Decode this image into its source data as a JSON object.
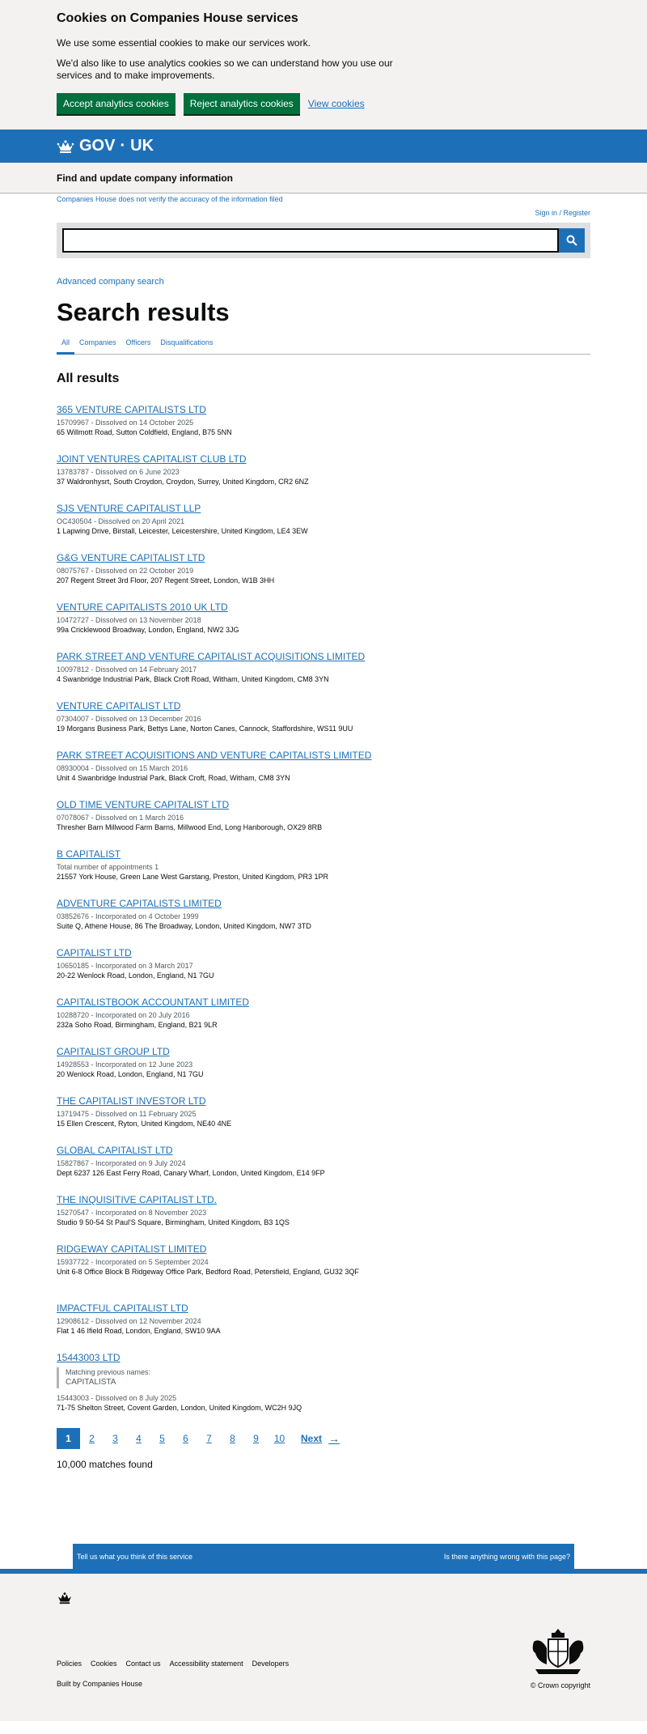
{
  "cookie": {
    "title": "Cookies on Companies House services",
    "p1": "We use some essential cookies to make our services work.",
    "p2": "We'd also like to use analytics cookies so we can understand how you use our services and to make improvements.",
    "accept_label": "Accept analytics cookies",
    "reject_label": "Reject analytics cookies",
    "view_label": "View cookies"
  },
  "header": {
    "logo": "GOV",
    "logo2": "UK",
    "service": "Find and update company information"
  },
  "notice": "Companies House does not verify the accuracy of the information filed",
  "signin": "Sign in / Register",
  "search": {
    "value": "",
    "icon": "search-icon"
  },
  "advanced_link": "Advanced company search",
  "page_title": "Search results",
  "tabs": [
    {
      "label": "All"
    },
    {
      "label": "Companies"
    },
    {
      "label": "Officers"
    },
    {
      "label": "Disqualifications"
    }
  ],
  "results_heading": "All results",
  "results": [
    {
      "title": "365 VENTURE CAPITALISTS LTD",
      "meta": "15709967 - Dissolved on 14 October 2025",
      "address": "65 Willmott Road, Sutton Coldfield, England, B75 5NN"
    },
    {
      "title": "JOINT VENTURES CAPITALIST CLUB LTD",
      "meta": "13783787 - Dissolved on 6 June 2023",
      "address": "37 Waldronhysrt, South Croydon, Croydon, Surrey, United Kingdom, CR2 6NZ"
    },
    {
      "title": "SJS VENTURE CAPITALIST LLP",
      "meta": "OC430504 - Dissolved on 20 April 2021",
      "address": "1 Lapwing Drive, Birstall, Leicester, Leicestershire, United Kingdom, LE4 3EW"
    },
    {
      "title": "G&G VENTURE CAPITALIST LTD",
      "meta": "08075767 - Dissolved on 22 October 2019",
      "address": "207 Regent Street 3rd Floor, 207 Regent Street, London, W1B 3HH"
    },
    {
      "title": "VENTURE CAPITALISTS 2010 UK LTD",
      "meta": "10472727 - Dissolved on 13 November 2018",
      "address": "99a Cricklewood Broadway, London, England, NW2 3JG"
    },
    {
      "title": "PARK STREET AND VENTURE CAPITALIST ACQUISITIONS LIMITED",
      "meta": "10097812 - Dissolved on 14 February 2017",
      "address": "4 Swanbridge Industrial Park, Black Croft Road, Witham, United Kingdom, CM8 3YN"
    },
    {
      "title": "VENTURE CAPITALIST LTD",
      "meta": "07304007 - Dissolved on 13 December 2016",
      "address": "19 Morgans Business Park, Bettys Lane, Norton Canes, Cannock, Staffordshire, WS11 9UU"
    },
    {
      "title": "PARK STREET ACQUISITIONS AND VENTURE CAPITALISTS LIMITED",
      "meta": "08930004 - Dissolved on 15 March 2016",
      "address": "Unit 4 Swanbridge Industrial Park, Black Croft, Road, Witham, CM8 3YN"
    },
    {
      "title": "OLD TIME VENTURE CAPITALIST LTD",
      "meta": "07078067 - Dissolved on 1 March 2016",
      "address": "Thresher Barn Millwood Farm Barns, Millwood End, Long Hanborough, OX29 8RB"
    },
    {
      "title": "B CAPITALIST",
      "meta": "Total number of appointments 1",
      "address": "21557 York House, Green Lane West Garstang, Preston, United Kingdom, PR3 1PR"
    },
    {
      "title": "ADVENTURE CAPITALISTS LIMITED",
      "meta": "03852676 - Incorporated on 4 October 1999",
      "address": "Suite Q, Athene House, 86 The Broadway, London, United Kingdom, NW7 3TD"
    },
    {
      "title": "CAPITALIST LTD",
      "meta": "10650185 - Incorporated on 3 March 2017",
      "address": "20-22 Wenlock Road, London, England, N1 7GU"
    },
    {
      "title": "CAPITALISTBOOK ACCOUNTANT LIMITED",
      "meta": "10288720 - Incorporated on 20 July 2016",
      "address": "232a Soho Road, Birmingham, England, B21 9LR"
    },
    {
      "title": "CAPITALIST GROUP LTD",
      "meta": "14928553 - Incorporated on 12 June 2023",
      "address": "20 Wenlock Road, London, England, N1 7GU"
    },
    {
      "title": "THE CAPITALIST INVESTOR LTD",
      "meta": "13719475 - Dissolved on 11 February 2025",
      "address": "15 Ellen Crescent, Ryton, United Kingdom, NE40 4NE"
    },
    {
      "title": "GLOBAL CAPITALIST LTD",
      "meta": "15827867 - Incorporated on 9 July 2024",
      "address": "Dept 6237 126 East Ferry Road, Canary Wharf, London, United Kingdom, E14 9FP"
    },
    {
      "title": "THE INQUISITIVE CAPITALIST LTD.",
      "meta": "15270547 - Incorporated on 8 November 2023",
      "address": "Studio 9 50-54 St Paul'S Square, Birmingham, United Kingdom, B3 1QS"
    },
    {
      "title": "RIDGEWAY CAPITALIST LIMITED",
      "meta": "15937722 - Incorporated on 5 September 2024",
      "address": "Unit 6-8 Office Block B Ridgeway Office Park, Bedford Road, Petersfield, England, GU32 3QF"
    },
    {
      "title": "IMPACTFUL CAPITALIST LTD",
      "meta": "12908612 - Dissolved on 12 November 2024",
      "address": "Flat 1 46 Ifield Road, London, England, SW10 9AA"
    },
    {
      "title": "15443003 LTD",
      "prev_label": "Matching previous names:",
      "prev_value": "CAPITALISTA",
      "meta": "15443003 - Dissolved on 8 July 2025",
      "address": "71-75 Shelton Street, Covent Garden, London, United Kingdom, WC2H 9JQ"
    }
  ],
  "pagination": {
    "pages": [
      "1",
      "2",
      "3",
      "4",
      "5",
      "6",
      "7",
      "8",
      "9",
      "10"
    ],
    "current": "1",
    "next_label": "Next",
    "count": "10,000 matches found"
  },
  "feedback": {
    "left": "Tell us what you think of this service",
    "right": "Is there anything wrong with this page?"
  },
  "footer": {
    "links": [
      "Policies",
      "Cookies",
      "Contact us",
      "Accessibility statement",
      "Developers"
    ],
    "built_prefix": "Built by ",
    "built_link": "Companies House",
    "copyright": "© Crown copyright"
  },
  "colors": {
    "brand_blue": "#1d70b8",
    "accept_green": "#00703c",
    "grey_bg": "#f3f2f1"
  }
}
